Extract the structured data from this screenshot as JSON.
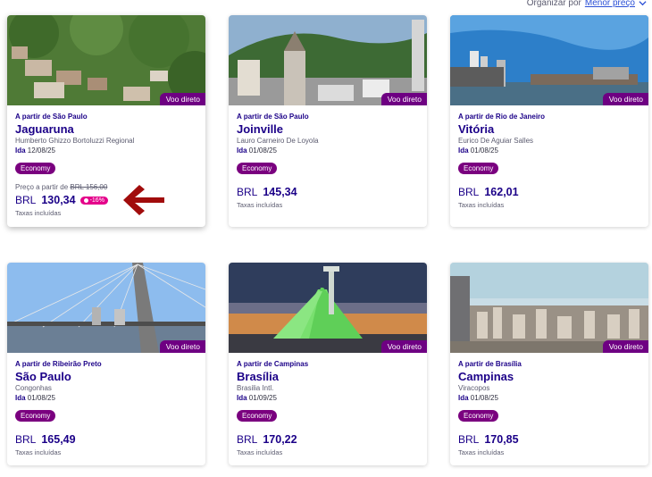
{
  "sort": {
    "label": "Organizar por",
    "value": "Menor preço"
  },
  "colors": {
    "brand": "#1b0088",
    "accent": "#7a007f",
    "discount": "#e4008a",
    "arrow": "#a10c0c"
  },
  "cards": [
    {
      "origin": "A partir de São Paulo",
      "city": "Jaguaruna",
      "airport": "Humberto Ghizzo Bortoluzzi Regional",
      "date_label": "Ida",
      "date": "12/08/25",
      "badge": "Voo direto",
      "cabin": "Economy",
      "price_from_label": "Preço a partir de",
      "old_price": "BRL 156,00",
      "currency": "BRL",
      "price": "130,34",
      "discount": "-16%",
      "taxes": "Taxas incluídas",
      "image": "hillside-houses"
    },
    {
      "origin": "A partir de São Paulo",
      "city": "Joinville",
      "airport": "Lauro Carneiro De Loyola",
      "date_label": "Ida",
      "date": "01/08/25",
      "badge": "Voo direto",
      "cabin": "Economy",
      "currency": "BRL",
      "price": "145,34",
      "taxes": "Taxas incluídas",
      "image": "cathedral-city"
    },
    {
      "origin": "A partir de Rio de Janeiro",
      "city": "Vitória",
      "airport": "Eurico De Aguiar Salles",
      "date_label": "Ida",
      "date": "01/08/25",
      "badge": "Voo direto",
      "cabin": "Economy",
      "currency": "BRL",
      "price": "162,01",
      "taxes": "Taxas incluídas",
      "image": "harbor-skyline"
    },
    {
      "origin": "A partir de Ribeirão Preto",
      "city": "São Paulo",
      "airport": "Congonhas",
      "date_label": "Ida",
      "date": "01/08/25",
      "badge": "Voo direto",
      "cabin": "Economy",
      "currency": "BRL",
      "price": "165,49",
      "taxes": "Taxas incluídas",
      "image": "cable-bridge"
    },
    {
      "origin": "A partir de Campinas",
      "city": "Brasília",
      "airport": "Brasilia Intl.",
      "date_label": "Ida",
      "date": "01/09/25",
      "badge": "Voo direto",
      "cabin": "Economy",
      "currency": "BRL",
      "price": "170,22",
      "taxes": "Taxas incluídas",
      "image": "cathedral-night"
    },
    {
      "origin": "A partir de Brasília",
      "city": "Campinas",
      "airport": "Viracopos",
      "date_label": "Ida",
      "date": "01/08/25",
      "badge": "Voo direto",
      "cabin": "Economy",
      "currency": "BRL",
      "price": "170,85",
      "taxes": "Taxas incluídas",
      "image": "city-skyline"
    }
  ]
}
